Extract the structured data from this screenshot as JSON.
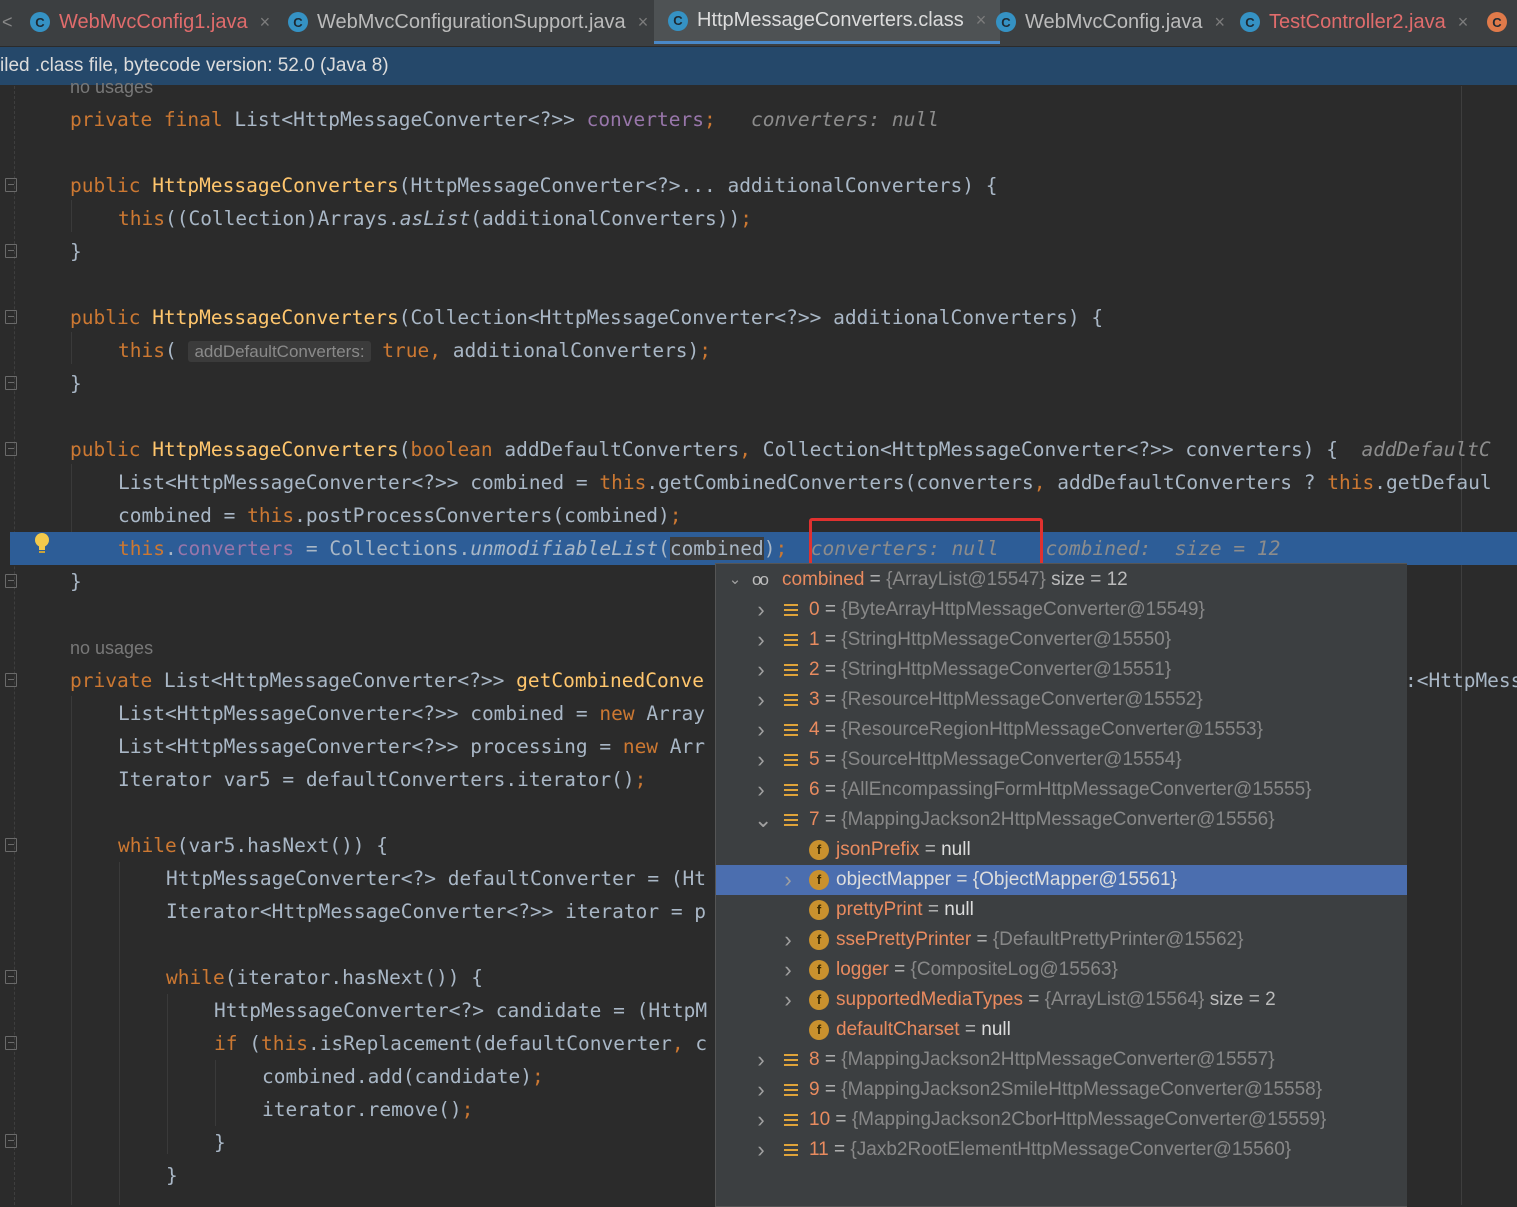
{
  "tabs": [
    {
      "label": "WebMvcConfig1.java",
      "state": "modified"
    },
    {
      "label": "WebMvcConfigurationSupport.java",
      "state": "normal"
    },
    {
      "label": "HttpMessageConverters.class",
      "state": "active"
    },
    {
      "label": "WebMvcConfig.java",
      "state": "normal"
    },
    {
      "label": "TestController2.java",
      "state": "modified"
    }
  ],
  "tab_icon_letter": "C",
  "tab_close_glyph": "×",
  "info_bar": "iled .class file, bytecode version: 52.0 (Java 8)",
  "code_hint_top": "no usages",
  "code_hint_mid": "no usages",
  "inlay": {
    "converters_field": "converters: null",
    "param_name": "addDefaultConverters:",
    "ctor_tail": "addDefaultC",
    "line_converters": "converters: null",
    "line_combined": "combined:  size = 12"
  },
  "colors": {
    "editor_bg": "#2b2b2b",
    "keyword": "#cc7832",
    "method": "#ffc66d",
    "field": "#9876aa",
    "highlight_line": "#2d5d97",
    "selected_row": "#4b6eaf",
    "red_box": "#e0312f"
  },
  "debug_popup": {
    "root": {
      "name": "combined",
      "value": "{ArrayList@15547}",
      "extra": "size = 12",
      "icon": "watch-glasses-icon"
    },
    "items": [
      {
        "index": "0",
        "value": "{ByteArrayHttpMessageConverter@15549}"
      },
      {
        "index": "1",
        "value": "{StringHttpMessageConverter@15550}"
      },
      {
        "index": "2",
        "value": "{StringHttpMessageConverter@15551}"
      },
      {
        "index": "3",
        "value": "{ResourceHttpMessageConverter@15552}"
      },
      {
        "index": "4",
        "value": "{ResourceRegionHttpMessageConverter@15553}"
      },
      {
        "index": "5",
        "value": "{SourceHttpMessageConverter@15554}"
      },
      {
        "index": "6",
        "value": "{AllEncompassingFormHttpMessageConverter@15555}"
      },
      {
        "index": "7",
        "value": "{MappingJackson2HttpMessageConverter@15556}"
      }
    ],
    "fields": [
      {
        "name": "jsonPrefix",
        "value": "null",
        "expandable": false,
        "selected": false
      },
      {
        "name": "objectMapper",
        "value": "{ObjectMapper@15561}",
        "expandable": true,
        "selected": true
      },
      {
        "name": "prettyPrint",
        "value": "null",
        "expandable": false,
        "selected": false
      },
      {
        "name": "ssePrettyPrinter",
        "value": "{DefaultPrettyPrinter@15562}",
        "expandable": true,
        "selected": false
      },
      {
        "name": "logger",
        "value": "{CompositeLog@15563}",
        "expandable": true,
        "selected": false
      },
      {
        "name": "supportedMediaTypes",
        "value": "{ArrayList@15564}",
        "extra": "size = 2",
        "expandable": true,
        "selected": false
      },
      {
        "name": "defaultCharset",
        "value": "null",
        "expandable": false,
        "selected": false
      }
    ],
    "items_after": [
      {
        "index": "8",
        "value": "{MappingJackson2HttpMessageConverter@15557}"
      },
      {
        "index": "9",
        "value": "{MappingJackson2SmileHttpMessageConverter@15558}"
      },
      {
        "index": "10",
        "value": "{MappingJackson2CborHttpMessageConverter@15559}"
      },
      {
        "index": "11",
        "value": "{Jaxb2RootElementHttpMessageConverter@15560}"
      }
    ],
    "field_icon_letter": "f",
    "equals": "="
  }
}
